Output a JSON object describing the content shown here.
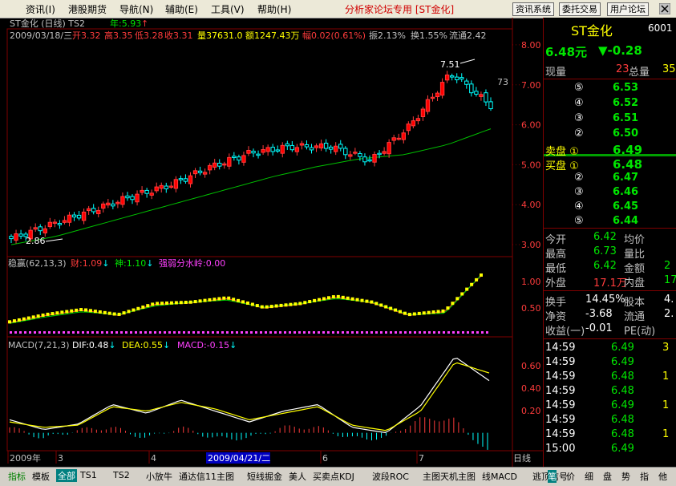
{
  "menu": [
    "资讯(I)",
    "港股期货",
    "导航(N)",
    "辅助(E)",
    "工具(V)",
    "帮助(H)"
  ],
  "center_title": "分析家论坛专用 [ST金化]",
  "top_buttons": [
    "资讯系统",
    "委托交易",
    "用户论坛"
  ],
  "chart": {
    "header_title": "ST金化 (日线) TS2",
    "year_label": "年:5.93",
    "info_date": "2009/03/18/三",
    "info_open_label": "开",
    "info_open": "3.32",
    "info_high_label": "高",
    "info_high": "3.35",
    "info_low_label": "低",
    "info_low": "3.28",
    "info_close_label": "收",
    "info_close": "3.31",
    "info_vol": "量37631.0",
    "info_amt": "额1247.43万",
    "info_chg": "幅0.02(0.61%)",
    "info_amp": "振2.13%",
    "info_turn": "换1.55%",
    "info_float": "流通2.42",
    "price_ticks": [
      "8.00",
      "7.00",
      "6.00",
      "5.00",
      "4.00",
      "3.00"
    ],
    "high_mark": "7.51",
    "low_mark": "2.86",
    "right_mark": "73",
    "ind1_title": "稳赢(62,13,3)",
    "ind1_cai": "财:1.09",
    "ind1_shen": "神:1.10",
    "ind1_qiang": "强弱分水岭:0.00",
    "ind1_ticks": [
      "1.00",
      "0.50"
    ],
    "macd_title": "MACD(7,21,3)",
    "macd_dif": "DIF:0.48",
    "macd_dea": "DEA:0.55",
    "macd_val": "MACD:-0.15",
    "macd_ticks": [
      "0.60",
      "0.40",
      "0.20"
    ],
    "x_labels": [
      "2009年",
      "3",
      "4",
      "5",
      "6",
      "7"
    ],
    "x_highlight": "2009/04/21/二",
    "period_label": "日线"
  },
  "chart_data": [
    {
      "type": "candlestick",
      "title": "ST金化 (日线) TS2",
      "ylim": [
        2.7,
        8.4
      ],
      "x": [
        "2009-01",
        "2009-03",
        "2009-04",
        "2009-05",
        "2009-06",
        "2009-07"
      ],
      "close": [
        3.15,
        3.5,
        3.85,
        4.2,
        4.5,
        4.95,
        5.3,
        5.45,
        5.45,
        5.1,
        6.0,
        7.3,
        6.48
      ],
      "ma": [
        3.0,
        3.2,
        3.5,
        3.8,
        4.1,
        4.4,
        4.7,
        4.95,
        5.15,
        5.25,
        5.5,
        5.9
      ]
    },
    {
      "type": "line",
      "title": "稳赢(62,13,3)",
      "ylim": [
        0.3,
        1.2
      ],
      "series": [
        {
          "name": "财",
          "values": [
            0.45,
            0.55,
            0.62,
            0.55,
            0.7,
            0.72,
            0.78,
            0.65,
            0.7,
            0.8,
            0.72,
            0.55,
            0.6,
            1.09
          ]
        },
        {
          "name": "神",
          "values": [
            0.44,
            0.53,
            0.6,
            0.56,
            0.68,
            0.73,
            0.76,
            0.66,
            0.71,
            0.78,
            0.73,
            0.56,
            0.58,
            1.1
          ]
        }
      ]
    },
    {
      "type": "line",
      "title": "MACD(7,21,3)",
      "ylim": [
        -0.15,
        0.75
      ],
      "series": [
        {
          "name": "DIF",
          "values": [
            0.12,
            0.03,
            0.08,
            0.26,
            0.18,
            0.3,
            0.2,
            0.1,
            0.2,
            0.26,
            0.05,
            0.0,
            0.25,
            0.7,
            0.48
          ]
        },
        {
          "name": "DEA",
          "values": [
            0.1,
            0.05,
            0.07,
            0.24,
            0.2,
            0.28,
            0.22,
            0.12,
            0.18,
            0.24,
            0.07,
            0.02,
            0.2,
            0.65,
            0.55
          ]
        }
      ],
      "MACD": -0.15
    }
  ],
  "quote": {
    "name": "ST金化",
    "code": "6001",
    "price": "6.48元",
    "change": "▼-0.28",
    "xianliang_label": "现量",
    "xianliang": "23",
    "zongliang_label": "总量",
    "zongliang": "35",
    "sell": [
      {
        "label": "⑤",
        "price": "6.53"
      },
      {
        "label": "④",
        "price": "6.52"
      },
      {
        "label": "③",
        "price": "6.51"
      },
      {
        "label": "②",
        "price": "6.50"
      },
      {
        "label": "卖盘 ①",
        "price": "6.49"
      }
    ],
    "buy": [
      {
        "label": "买盘 ①",
        "price": "6.48"
      },
      {
        "label": "②",
        "price": "6.47"
      },
      {
        "label": "③",
        "price": "6.46"
      },
      {
        "label": "④",
        "price": "6.45"
      },
      {
        "label": "⑤",
        "price": "6.44"
      }
    ],
    "stats": [
      {
        "k1": "今开",
        "v1": "6.42",
        "k2": "均价",
        "v2": ""
      },
      {
        "k1": "最高",
        "v1": "6.73",
        "k2": "量比",
        "v2": ""
      },
      {
        "k1": "最低",
        "v1": "6.42",
        "k2": "金额",
        "v2": "2"
      },
      {
        "k1": "外盘",
        "v1": "17.1万",
        "k2": "内盘",
        "v2": "17"
      }
    ],
    "stats2": [
      {
        "k1": "换手",
        "v1": "14.45%",
        "k2": "股本",
        "v2": "4."
      },
      {
        "k1": "净资",
        "v1": "-3.68",
        "k2": "流通",
        "v2": "2."
      },
      {
        "k1": "收益(一)",
        "v1": "-0.01",
        "k2": "PE(动)",
        "v2": ""
      }
    ],
    "ticks": [
      {
        "time": "14:59",
        "price": "6.49",
        "vol": "3"
      },
      {
        "time": "14:59",
        "price": "6.49",
        "vol": ""
      },
      {
        "time": "14:59",
        "price": "6.48",
        "vol": "1"
      },
      {
        "time": "14:59",
        "price": "6.48",
        "vol": ""
      },
      {
        "time": "14:59",
        "price": "6.49",
        "vol": "1"
      },
      {
        "time": "14:59",
        "price": "6.48",
        "vol": ""
      },
      {
        "time": "14:59",
        "price": "6.48",
        "vol": "1"
      },
      {
        "time": "15:00",
        "price": "6.49",
        "vol": ""
      }
    ]
  },
  "bottom_tabs": [
    "指标",
    "模板",
    "全部",
    "TS1",
    "TS2",
    "小放牛",
    "通达信11主图",
    "短线掘金",
    "美人",
    "买卖点KDJ",
    "波段ROC",
    "主图天机主图",
    "线MACD",
    "逃顶信号"
  ],
  "right_tabs": [
    "笔",
    "价",
    "细",
    "盘",
    "势",
    "指",
    "他"
  ]
}
